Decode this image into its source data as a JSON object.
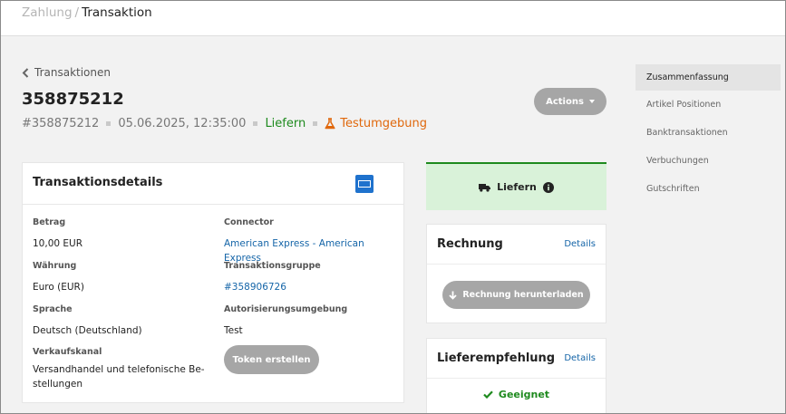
{
  "breadcrumb": {
    "parent": "Zahlung",
    "separator": "/",
    "current": "Transaktion"
  },
  "back_link": "Transaktionen",
  "transaction": {
    "title": "358875212",
    "id": "#358875212",
    "datetime": "05.06.2025, 12:35:00",
    "status": "Liefern",
    "environment": "Testumgebung"
  },
  "actions_label": "Actions",
  "details": {
    "title": "Transaktionsdetails",
    "card_logo": "american-express-icon",
    "fields": {
      "betrag": {
        "label": "Betrag",
        "value": "10,00 EUR"
      },
      "connector": {
        "label": "Connector",
        "value": "American Express - American Express"
      },
      "waehrung": {
        "label": "Währung",
        "value": "Euro (EUR)"
      },
      "gruppe": {
        "label": "Transaktionsgruppe",
        "value": "#358906726"
      },
      "sprache": {
        "label": "Sprache",
        "value": "Deutsch (Deutschland)"
      },
      "auth": {
        "label": "Autorisierungsumgebung",
        "value": "Test"
      },
      "kanal": {
        "label": "Verkaufskanal",
        "value_line1": "Versandhandel und telefonische Be-",
        "value_line2": "stellungen"
      }
    },
    "token_button": "Token erstellen"
  },
  "status_card": {
    "label": "Liefern",
    "icon": "truck-icon",
    "info_icon": "info-icon"
  },
  "invoice": {
    "title": "Rechnung",
    "details_link": "Details",
    "download_button": "Rechnung herunterladen"
  },
  "delivery": {
    "title": "Lieferempfehlung",
    "details_link": "Details",
    "result": "Geeignet"
  },
  "right_nav": {
    "items": [
      {
        "label": "Zusammenfassung",
        "active": true
      },
      {
        "label": "Artikel Positionen"
      },
      {
        "label": "Banktransaktionen"
      },
      {
        "label": "Verbuchungen"
      },
      {
        "label": "Gutschriften"
      }
    ]
  },
  "colors": {
    "success": "#1e8a1e",
    "warning": "#e0680c",
    "link": "#1565a8",
    "button_disabled": "#a6a6a6",
    "status_bg": "#d9f2d9"
  }
}
